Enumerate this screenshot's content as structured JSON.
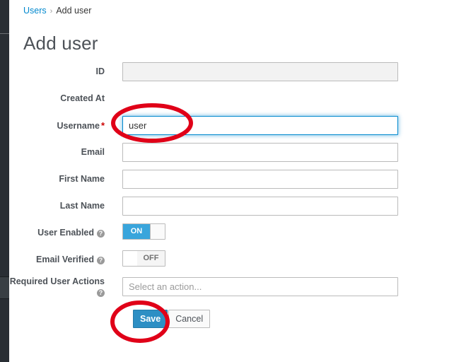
{
  "breadcrumb": {
    "parent": "Users",
    "separator": "›",
    "current": "Add user"
  },
  "page": {
    "title": "Add user"
  },
  "form": {
    "fields": [
      {
        "label": "ID",
        "required": false,
        "help": false,
        "control": "text",
        "value": "",
        "placeholder": "",
        "state": "disabled"
      },
      {
        "label": "Created At",
        "required": false,
        "help": false,
        "control": "none",
        "value": "",
        "placeholder": "",
        "state": "none"
      },
      {
        "label": "Username",
        "required": true,
        "help": false,
        "control": "text",
        "value": "user",
        "placeholder": "",
        "state": "focused"
      },
      {
        "label": "Email",
        "required": false,
        "help": false,
        "control": "text",
        "value": "",
        "placeholder": "",
        "state": "normal"
      },
      {
        "label": "First Name",
        "required": false,
        "help": false,
        "control": "text",
        "value": "",
        "placeholder": "",
        "state": "normal"
      },
      {
        "label": "Last Name",
        "required": false,
        "help": false,
        "control": "text",
        "value": "",
        "placeholder": "",
        "state": "normal"
      },
      {
        "label": "User Enabled",
        "required": false,
        "help": true,
        "control": "toggle",
        "value": "ON",
        "placeholder": "",
        "state": "on"
      },
      {
        "label": "Email Verified",
        "required": false,
        "help": true,
        "control": "toggle",
        "value": "OFF",
        "placeholder": "",
        "state": "off"
      },
      {
        "label": "Required User Actions",
        "required": false,
        "help": true,
        "control": "select",
        "value": "",
        "placeholder": "Select an action...",
        "state": "normal"
      }
    ],
    "required_marker": "*",
    "help_icon_glyph": "?",
    "help_icon_name": "help-circle-icon"
  },
  "buttons": {
    "save": "Save",
    "cancel": "Cancel"
  },
  "annotations": [
    {
      "name": "username-field-highlight",
      "shape": "ellipse",
      "color": "#e00018"
    },
    {
      "name": "save-button-highlight",
      "shape": "ellipse",
      "color": "#e00018"
    }
  ],
  "colors": {
    "accent": "#0088ce",
    "primary_button": "#2d8fc4",
    "toggle_on": "#39a5dc",
    "required": "#cc0000",
    "annotation": "#e00018",
    "sidebar": "#292e34"
  }
}
